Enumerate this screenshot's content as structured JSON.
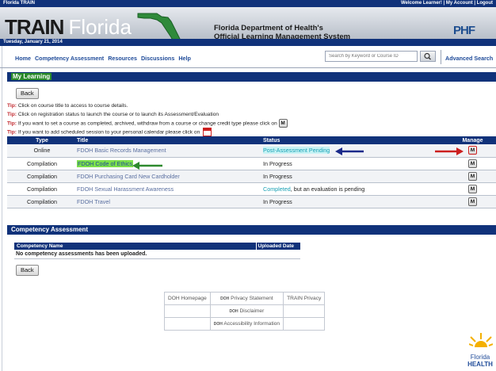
{
  "top_bar": {
    "left_label": "Florida TRAIN",
    "right_label": "Welcome Learner! | My Account | Logout"
  },
  "banner": {
    "brand_train": "TRAIN",
    "brand_florida": "Florida",
    "title_line1": "Florida Department of Health's",
    "title_line2": "Official Learning Management System",
    "partner_logo": "PHF"
  },
  "date_bar": {
    "date": "Tuesday, January 21, 2014"
  },
  "nav": {
    "links": [
      "Home",
      "Competency Assessment",
      "Resources",
      "Discussions",
      "Help"
    ],
    "search_placeholder": "Search by Keyword or Course ID",
    "advanced_search": "Advanced Search"
  },
  "my_learning": {
    "heading": "My Learning",
    "back_label": "Back",
    "tip_label": "Tip:",
    "tips": [
      "Click on course title to access to course details.",
      "Click on registration status to launch the course or to launch its Assessment/Evaluation",
      "If you want to set a course as completed, archived, withdraw from a course or change credit type please click on",
      "If you want to add scheduled session to your personal calendar please click on"
    ],
    "manage_icon_label": "M",
    "table": {
      "headers": [
        "Type",
        "Title",
        "Status",
        "Manage"
      ],
      "rows": [
        {
          "type": "Online",
          "title": "FDOH Basic Records Management",
          "status": "Post-Assessment Pending",
          "status_extra": "",
          "manage": "M"
        },
        {
          "type": "Compilation",
          "title": "FDOH Code of Ethics",
          "status": "In Progress",
          "status_extra": "",
          "manage": "M"
        },
        {
          "type": "Compilation",
          "title": "FDOH Purchasing Card New Cardholder",
          "status": "In Progress",
          "status_extra": "",
          "manage": "M"
        },
        {
          "type": "Compilation",
          "title": "FDOH Sexual Harassment Awareness",
          "status": "Completed",
          "status_extra": ", but an evaluation is pending",
          "manage": "M"
        },
        {
          "type": "Compilation",
          "title": "FDOH Travel",
          "status": "In Progress",
          "status_extra": "",
          "manage": "M"
        }
      ]
    }
  },
  "competency": {
    "heading": "Competency Assessment",
    "headers": [
      "Competency Name",
      "Uploaded Date"
    ],
    "empty_message": "No competency assessments has been uploaded.",
    "back_label": "Back"
  },
  "footer": {
    "homepage": "DOH Homepage",
    "privacy": "Privacy Statement",
    "train_privacy": "TRAIN Privacy",
    "disclaimer": "Disclaimer",
    "accessibility": "Accessibility Information",
    "doh_prefix": "DOH"
  },
  "florida_health_logo": {
    "line1": "Florida",
    "line2": "HEALTH"
  },
  "colors": {
    "navy": "#10327a",
    "link_blue": "#1f4b99",
    "tip_red": "#c1272d",
    "highlight_green": "#7de04a",
    "status_teal": "#1aa1b5",
    "arrow_blue": "#1a2a8a",
    "arrow_green": "#2e8a2e",
    "arrow_red": "#cc1f1f"
  },
  "icons": [
    "search-icon",
    "manage-icon",
    "calendar-icon",
    "florida-map-icon",
    "arrow-icon"
  ]
}
